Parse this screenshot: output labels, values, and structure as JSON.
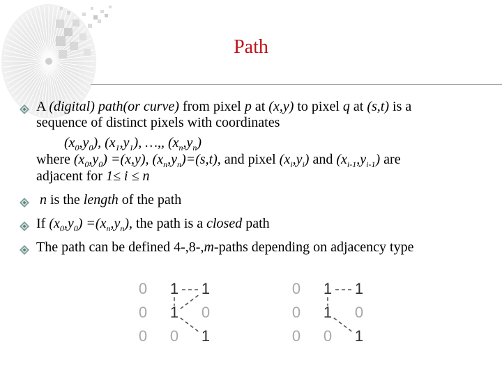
{
  "slide": {
    "title": "Path",
    "title_color": "#c0141a",
    "bullet_icon": "diamond-bullet-icon"
  },
  "bullets": [
    {
      "lines": [
        [
          "A ",
          {
            "i": "(digital) path(or curve)"
          },
          " from pixel ",
          {
            "i": "p"
          },
          " at ",
          {
            "i": "(x,y)"
          },
          " to pixel ",
          {
            "i": "q"
          },
          " at ",
          {
            "i": "(s,t)"
          },
          " is a"
        ],
        [
          "sequence of distinct pixels with coordinates"
        ],
        [
          "        ",
          {
            "i": "(x"
          },
          {
            "isub": "0"
          },
          {
            "i": ",y"
          },
          {
            "isub": "0"
          },
          {
            "i": "), (x"
          },
          {
            "isub": "1"
          },
          {
            "i": ",y"
          },
          {
            "isub": "1"
          },
          {
            "i": "), …,, (x"
          },
          {
            "isub": "n"
          },
          {
            "i": ",y"
          },
          {
            "isub": "n"
          },
          {
            "i": ")"
          }
        ],
        [
          "where ",
          {
            "i": "(x"
          },
          {
            "isub": "0"
          },
          {
            "i": ",y"
          },
          {
            "isub": "0"
          },
          {
            "i": ") =(x,y), (x"
          },
          {
            "isub": "n"
          },
          {
            "i": ",y"
          },
          {
            "isub": "n"
          },
          {
            "i": ")=(s,t),"
          },
          " and pixel ",
          {
            "i": "(x"
          },
          {
            "isub": "i"
          },
          {
            "i": ",y"
          },
          {
            "isub": "i"
          },
          {
            "i": ")"
          },
          " and ",
          {
            "i": "(x"
          },
          {
            "isub": "i-1"
          },
          {
            "i": ",y"
          },
          {
            "isub": "i-1"
          },
          {
            "i": ")"
          },
          " are"
        ],
        [
          "adjacent for ",
          {
            "i": "1≤ i ≤ n"
          }
        ]
      ]
    },
    {
      "lines": [
        [
          " ",
          {
            "i": "n"
          },
          " is the ",
          {
            "i": "length"
          },
          " of the path"
        ]
      ]
    },
    {
      "lines": [
        [
          "If ",
          {
            "i": "(x"
          },
          {
            "isub": "0"
          },
          {
            "i": ",y"
          },
          {
            "isub": "0"
          },
          {
            "i": ") =(x"
          },
          {
            "isub": "n"
          },
          {
            "i": ",y"
          },
          {
            "isub": "n"
          },
          {
            "i": "),"
          },
          " the path is a ",
          {
            "i": "closed"
          },
          " path"
        ]
      ]
    },
    {
      "lines": [
        [
          "The path can be defined 4-,8-,",
          {
            "i": "m"
          },
          "-paths depending on adjacency type"
        ]
      ]
    }
  ],
  "figures": [
    {
      "name": "8-path-example",
      "grid": [
        [
          "0",
          "1",
          "1"
        ],
        [
          "0",
          "1",
          "0"
        ],
        [
          "0",
          "0",
          "1"
        ]
      ],
      "links": [
        [
          [
            0,
            1
          ],
          [
            0,
            2
          ]
        ],
        [
          [
            0,
            1
          ],
          [
            1,
            1
          ]
        ],
        [
          [
            1,
            1
          ],
          [
            0,
            2
          ]
        ],
        [
          [
            1,
            1
          ],
          [
            2,
            2
          ]
        ]
      ]
    },
    {
      "name": "m-path-example",
      "grid": [
        [
          "0",
          "1",
          "1"
        ],
        [
          "0",
          "1",
          "0"
        ],
        [
          "0",
          "0",
          "1"
        ]
      ],
      "links": [
        [
          [
            0,
            1
          ],
          [
            0,
            2
          ]
        ],
        [
          [
            0,
            1
          ],
          [
            1,
            1
          ]
        ],
        [
          [
            1,
            1
          ],
          [
            2,
            2
          ]
        ]
      ]
    }
  ]
}
